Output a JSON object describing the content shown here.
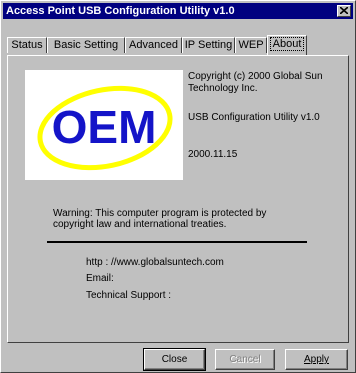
{
  "window": {
    "title": "Access Point USB Configuration Utility v1.0"
  },
  "tabs": [
    {
      "label": "Status"
    },
    {
      "label": "Basic Setting"
    },
    {
      "label": "Advanced"
    },
    {
      "label": "IP Setting"
    },
    {
      "label": "WEP"
    },
    {
      "label": "About"
    }
  ],
  "about": {
    "logo_text": "OEM",
    "copyright": "Copyright (c) 2000 Global Sun",
    "company": "Technology Inc.",
    "product": "USB Configuration  Utility v1.0",
    "date": "2000.11.15",
    "warning_line1": "Warning: This computer program is protected by",
    "warning_line2": "copyright law and international treaties.",
    "website": "http : //www.globalsuntech.com",
    "email_label": "Email:",
    "support_label": "Technical Support :"
  },
  "buttons": {
    "close": "Close",
    "cancel": "Cancel",
    "apply": "Apply"
  },
  "colors": {
    "titlebar": "#000080",
    "logo_blue": "#1414c8",
    "logo_ring": "#ffff00",
    "face": "#c0c0c0"
  }
}
